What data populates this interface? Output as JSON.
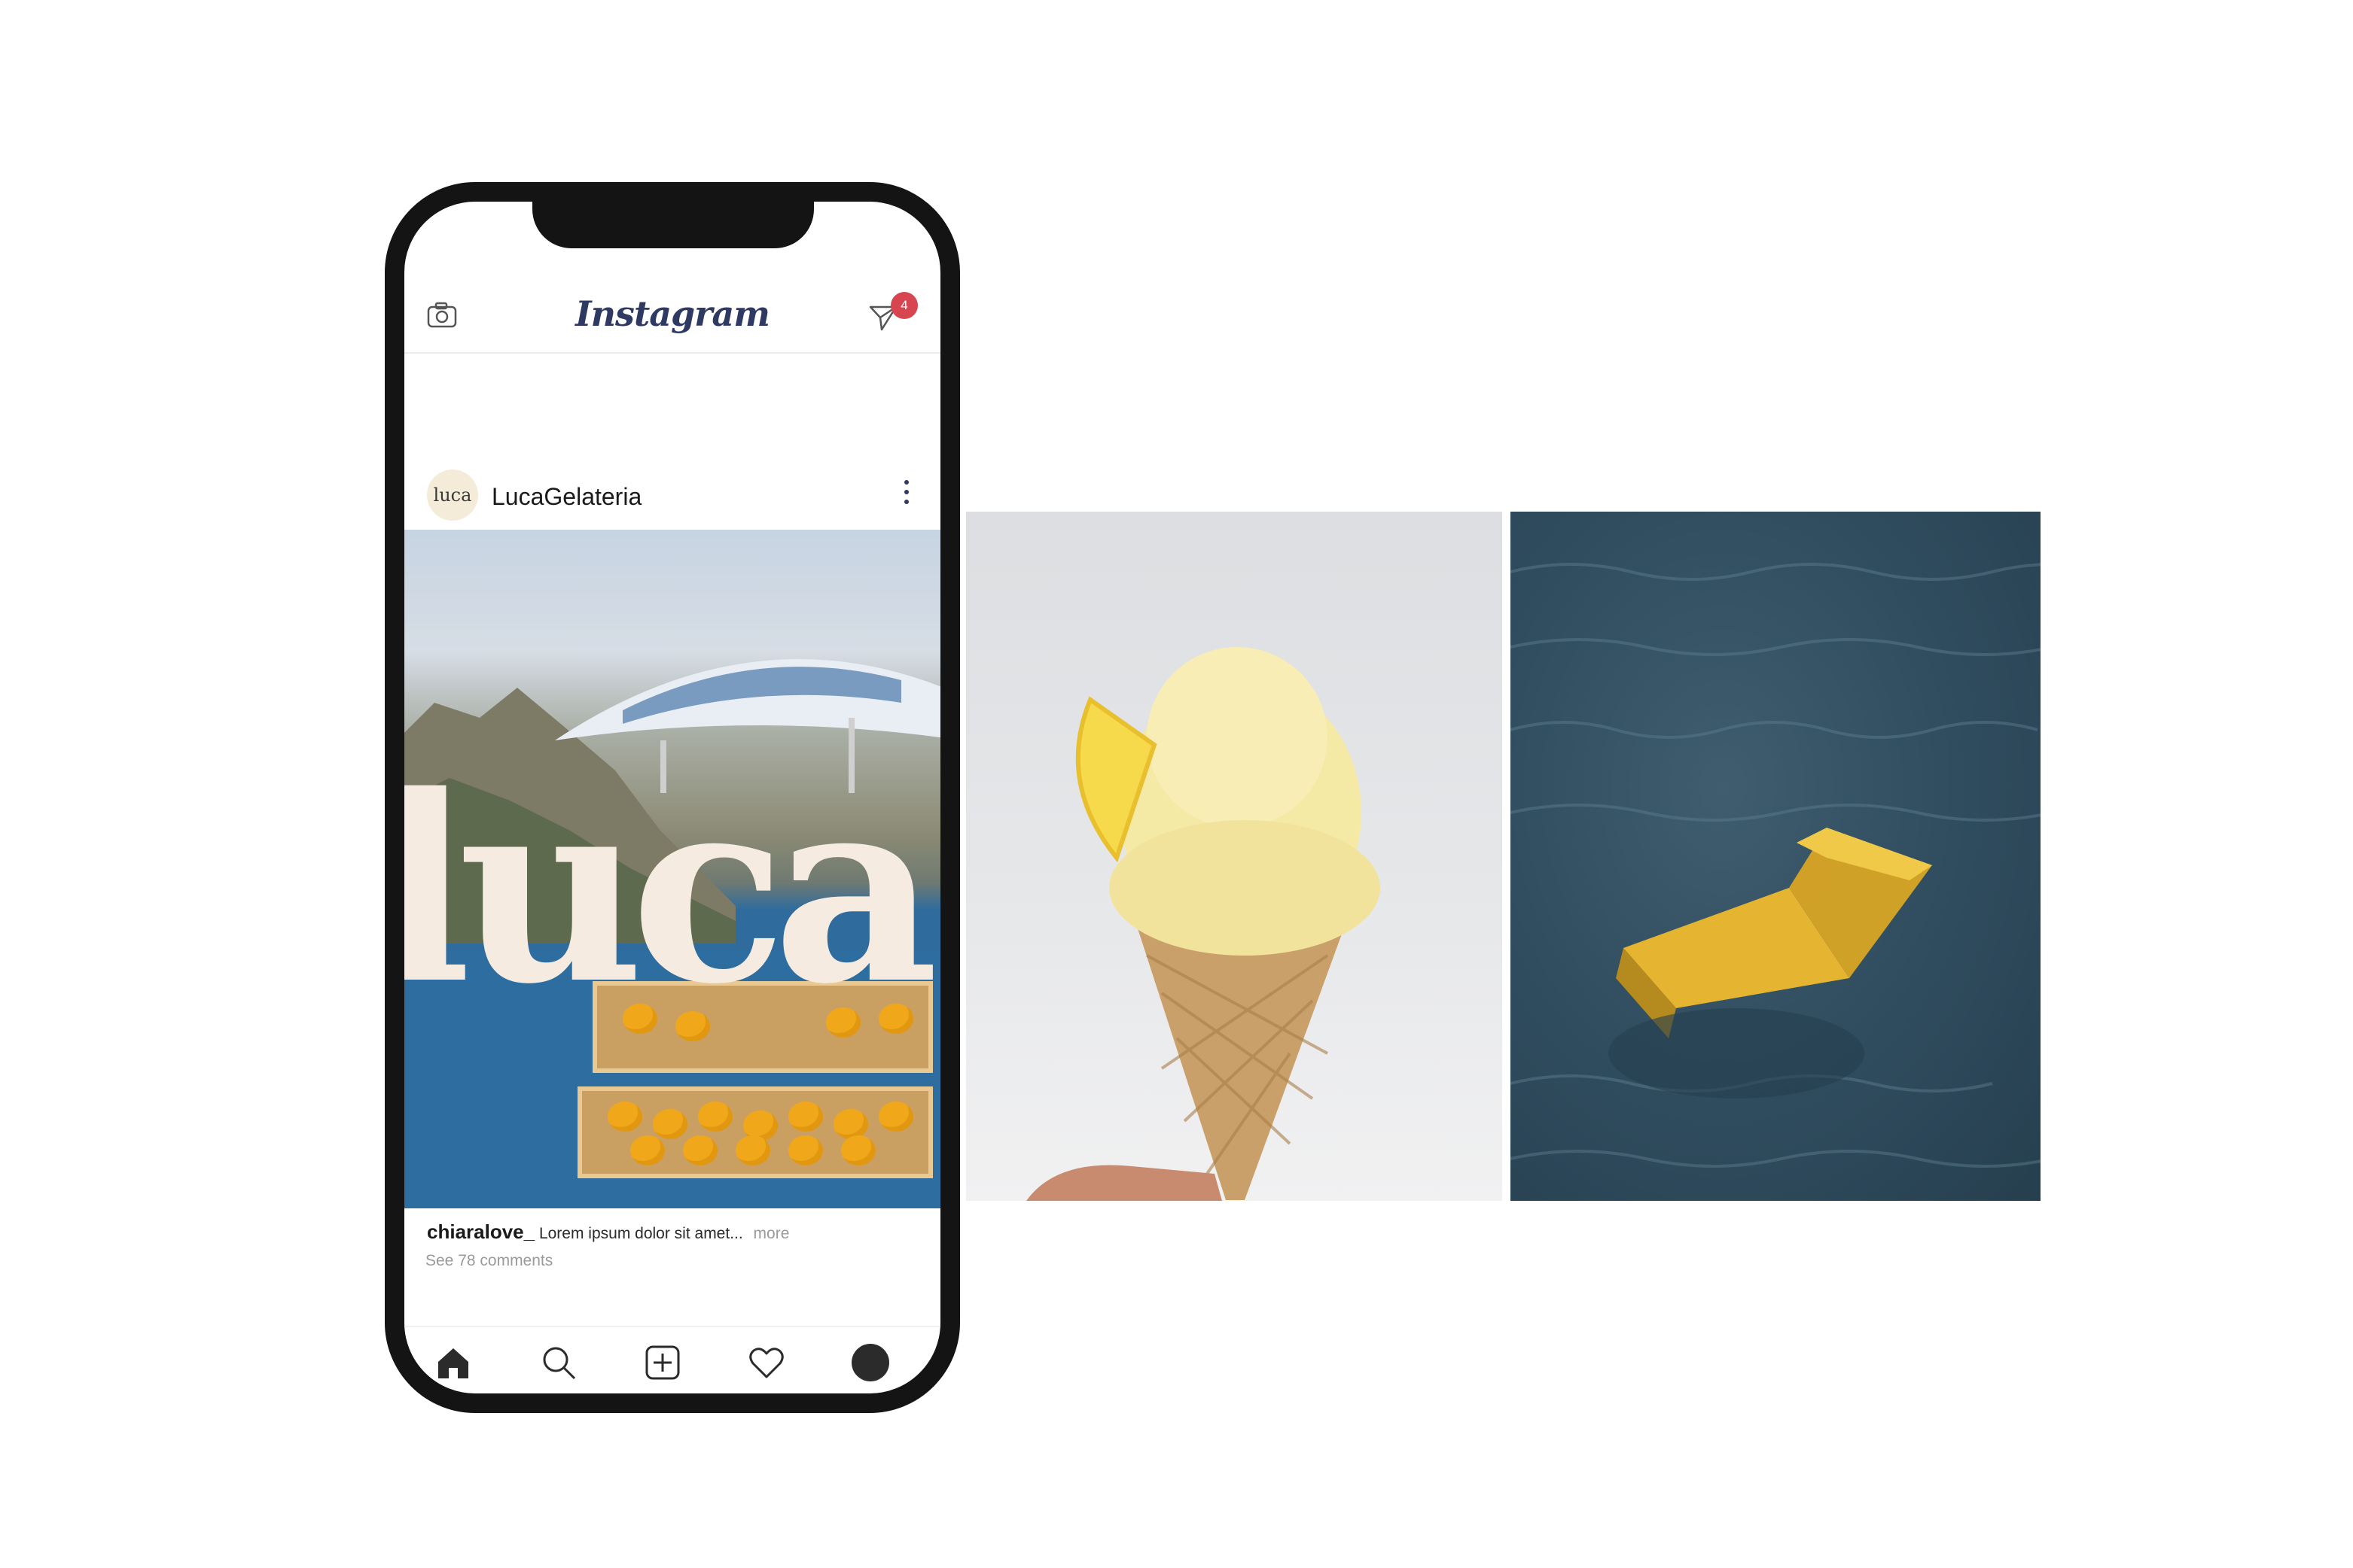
{
  "app": {
    "logo_text": "Instagram",
    "notification_count": "4"
  },
  "post": {
    "avatar_text": "luca",
    "username": "LucaGelateria",
    "image_overlay_text": "luca",
    "caption": {
      "user": "chiaralove_",
      "text": "Lorem ipsum dolor sit amet...",
      "more_label": "more"
    },
    "comments_link": "See 78 comments"
  },
  "tabs": [
    {
      "icon": "home-icon"
    },
    {
      "icon": "search-icon"
    },
    {
      "icon": "add-post-icon"
    },
    {
      "icon": "heart-icon"
    },
    {
      "icon": "profile-icon"
    }
  ],
  "photos": [
    {
      "icon": "ice-cream-cone-photo"
    },
    {
      "icon": "chair-in-water-photo"
    }
  ],
  "colors": {
    "logo": "#2f3a63",
    "badge": "#d64550",
    "frame": "#141414",
    "overlay_text": "#f5ebe0"
  }
}
